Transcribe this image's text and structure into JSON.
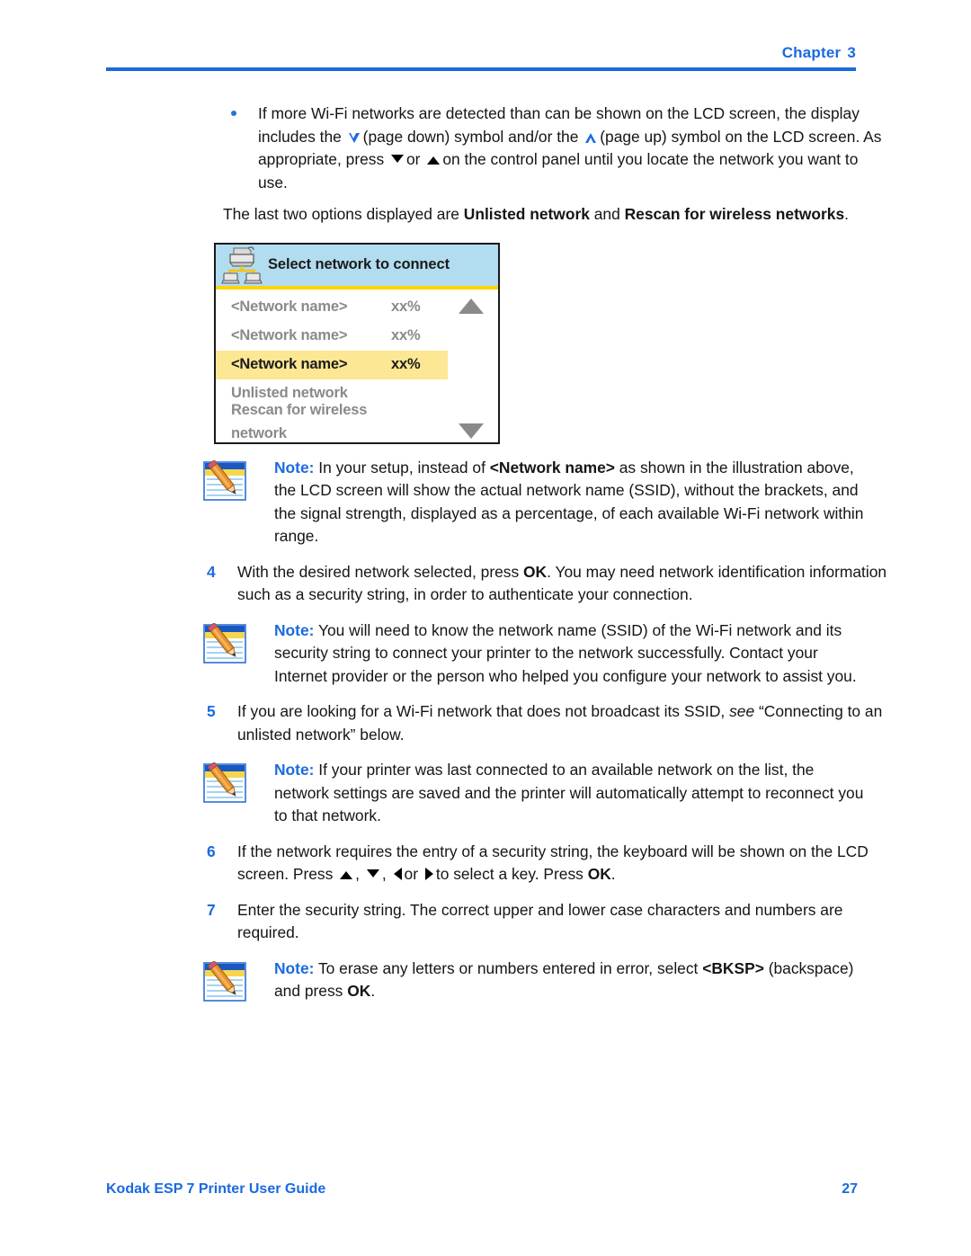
{
  "header": {
    "chapter_label": "Chapter",
    "chapter_number": "3"
  },
  "bullet": {
    "text_1": "If more Wi-Fi networks are detected than can be shown on the LCD screen, the display includes the",
    "text_2": "(page down) symbol and/or the",
    "text_3": "(page up) symbol on the LCD screen. As appropriate, press",
    "text_4": "or",
    "text_5": "on the control panel until you locate the network you want to use."
  },
  "paragraph_last_two": {
    "text_1": "The last two options displayed are ",
    "bold_1": "Unlisted network",
    "text_2": " and ",
    "bold_2": "Rescan for wireless networks",
    "text_3": "."
  },
  "lcd": {
    "title": "Select network to connect",
    "icon": "printer-network-icon",
    "scroll_up_icon": "scroll-up-arrow-icon",
    "scroll_down_icon": "scroll-down-arrow-icon",
    "title_bar_color": "#b2dcef",
    "title_underline_color": "#ffd400",
    "highlight_color": "#fce794",
    "rows": [
      {
        "name": "<Network name>",
        "percent": "xx%",
        "selected": false
      },
      {
        "name": "<Network name>",
        "percent": "xx%",
        "selected": false
      },
      {
        "name": "<Network name>",
        "percent": "xx%",
        "selected": true
      },
      {
        "name": "Unlisted network",
        "percent": "",
        "selected": false
      },
      {
        "name": "Rescan for wireless network",
        "percent": "",
        "selected": false
      }
    ]
  },
  "notes": {
    "label": "Note:",
    "note_1": {
      "text_1": "In your setup, instead of ",
      "bold_1": "<Network name>",
      "text_2": " as shown in the illustration above, the LCD screen will show the actual network name (SSID), without the brackets, and the signal strength, displayed as a percentage, of each available Wi-Fi network within range."
    },
    "note_2": {
      "text_1": "You will need to know the network name (SSID) of the Wi-Fi network and its security string to connect your printer to the network successfully. Contact your Internet provider or the person who helped you configure your network to assist you."
    },
    "note_3": {
      "text_1": "If your printer was last connected to an available network on the list, the network settings are saved and the printer will automatically attempt to reconnect you to that network."
    },
    "note_4": {
      "text_1": "To erase any letters or numbers entered in error, select ",
      "bold_1": "<BKSP>",
      "text_2": " (backspace) and press ",
      "bold_2": "OK",
      "text_3": "."
    }
  },
  "steps": {
    "step_4": {
      "number": "4",
      "text_1": "With the desired network selected, press ",
      "bold_1": "OK",
      "text_2": ". You may need network identification information such as a security string, in order to authenticate your connection."
    },
    "step_5": {
      "number": "5",
      "text_1": "If you are looking for a Wi-Fi network that does not broadcast its SSID, ",
      "italic_1": "see",
      "text_2": " “Connecting to an unlisted network” below."
    },
    "step_6": {
      "number": "6",
      "text_1": "If the network requires the entry of a security string, the keyboard will be shown on the LCD screen. Press",
      "text_2": ",",
      "text_3": ",",
      "text_4": "or",
      "text_5": "to select a key. Press ",
      "bold_1": "OK",
      "text_6": "."
    },
    "step_7": {
      "number": "7",
      "text_1": "Enter the security string. The correct upper and lower case characters and numbers are required."
    }
  },
  "footer": {
    "guide_title": "Kodak ESP 7 Printer User Guide",
    "page_number": "27"
  },
  "colors": {
    "accent_blue": "#1a6ae0",
    "lcd_header": "#b2dcef",
    "lcd_highlight": "#fce794",
    "lcd_yellow_rule": "#ffd400"
  }
}
